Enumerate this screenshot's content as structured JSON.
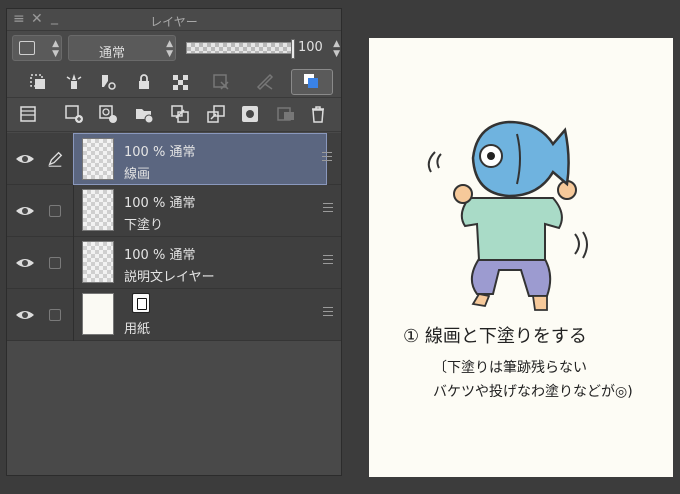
{
  "panel": {
    "title": "レイヤー",
    "blend_mode": "通常",
    "opacity_value": "100",
    "opacity_fraction": 1.0
  },
  "layers": [
    {
      "opacity": "100 %",
      "mode": "通常",
      "name": "線画",
      "selected": true,
      "locked": false
    },
    {
      "opacity": "100 %",
      "mode": "通常",
      "name": "下塗り",
      "selected": false,
      "locked": false
    },
    {
      "opacity": "100 %",
      "mode": "通常",
      "name": "説明文レイヤー",
      "selected": false,
      "locked": false
    },
    {
      "opacity": "",
      "mode": "",
      "name": "用紙",
      "selected": false,
      "locked": false
    }
  ],
  "canvas": {
    "note_line1": "① 線画と下塗りをする",
    "note_line2": "〔下塗りは筆跡残らない",
    "note_line3": "バケツや投げなわ塗りなどが◎)"
  },
  "colors": {
    "accent": "#5b6680",
    "fish": "#6fb3df",
    "shirt": "#a9dbc7",
    "pants": "#9c9bd0",
    "skin": "#f6c99a",
    "canvas_bg": "#fdfcf5"
  }
}
